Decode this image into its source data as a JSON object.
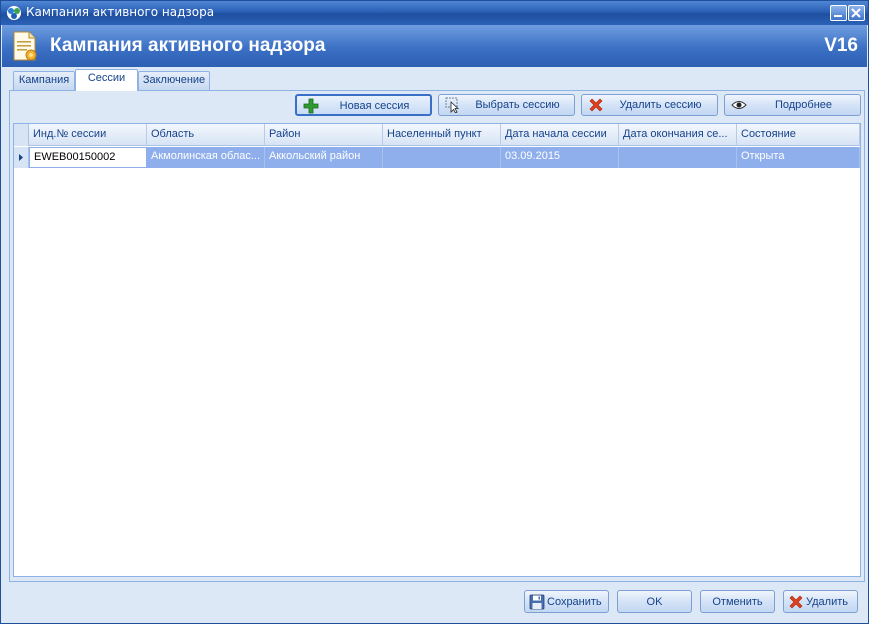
{
  "window": {
    "title": "Кампания активного надзора",
    "icon": "app-logo-icon",
    "controls": [
      "minimize-icon",
      "close-icon"
    ]
  },
  "header": {
    "title": "Кампания активного надзора",
    "version": "V16",
    "icon": "document-certificate-icon"
  },
  "tabs": [
    {
      "label": "Кампания",
      "active": false
    },
    {
      "label": "Сессии",
      "active": true
    },
    {
      "label": "Заключение",
      "active": false
    }
  ],
  "toolbar": {
    "new_session": "Новая сессия",
    "select_session": "Выбрать сессию",
    "delete_session": "Удалить сессию",
    "details": "Подробнее"
  },
  "grid": {
    "columns": [
      "Инд.№ сессии",
      "Область",
      "Район",
      "Населенный пункт",
      "Дата начала сессии",
      "Дата окончания се...",
      "Состояние"
    ],
    "rows": [
      [
        "EWEB00150002",
        "Акмолинская облас...",
        "Аккольский район",
        "",
        "03.09.2015",
        "",
        "Открыта"
      ]
    ]
  },
  "footer": {
    "save": "Сохранить",
    "ok": "OK",
    "cancel": "Отменить",
    "delete": "Удалить"
  },
  "colors": {
    "accent": "#2d5fb3",
    "selected_row": "#8fafec",
    "panel": "#dde8f6"
  }
}
